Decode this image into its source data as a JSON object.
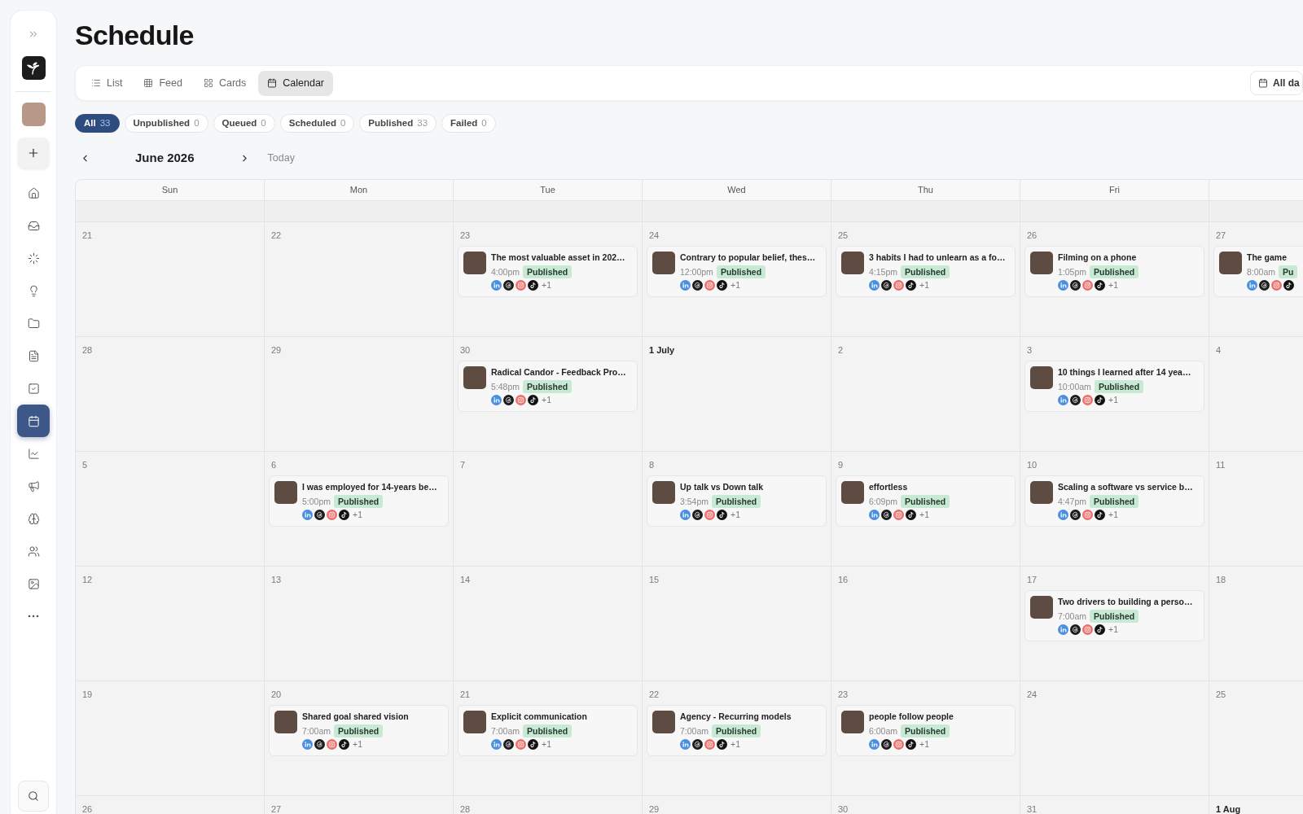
{
  "sidebar": {
    "nav": [
      {
        "kind": "home",
        "selected": false
      },
      {
        "kind": "inbox",
        "selected": false
      },
      {
        "kind": "loader",
        "selected": false
      },
      {
        "kind": "lightbulb",
        "selected": false
      },
      {
        "kind": "folder",
        "selected": false
      },
      {
        "kind": "document",
        "selected": false
      },
      {
        "kind": "checklist",
        "selected": false
      },
      {
        "kind": "calendar",
        "selected": true
      },
      {
        "kind": "chart",
        "selected": false
      },
      {
        "kind": "megaphone",
        "selected": false
      },
      {
        "kind": "brain",
        "selected": false
      },
      {
        "kind": "users",
        "selected": false
      },
      {
        "kind": "image",
        "selected": false
      },
      {
        "kind": "more",
        "selected": false
      }
    ]
  },
  "page": {
    "title": "Schedule"
  },
  "view_tabs": [
    {
      "kind": "list",
      "label": "List",
      "selected": false
    },
    {
      "kind": "feed",
      "label": "Feed",
      "selected": false
    },
    {
      "kind": "cards",
      "label": "Cards",
      "selected": false
    },
    {
      "kind": "calendar",
      "label": "Calendar",
      "selected": true
    }
  ],
  "date_range_button": {
    "label": "All da"
  },
  "filters": [
    {
      "label": "All",
      "count": "33",
      "selected": true
    },
    {
      "label": "Unpublished",
      "count": "0",
      "selected": false
    },
    {
      "label": "Queued",
      "count": "0",
      "selected": false
    },
    {
      "label": "Scheduled",
      "count": "0",
      "selected": false
    },
    {
      "label": "Published",
      "count": "33",
      "selected": false
    },
    {
      "label": "Failed",
      "count": "0",
      "selected": false
    }
  ],
  "month_nav": {
    "month": "June 2026",
    "today": "Today"
  },
  "calendar": {
    "weekdays": [
      "Sun",
      "Mon",
      "Tue",
      "Wed",
      "Thu",
      "Fri"
    ],
    "weeks": [
      {
        "days": [
          {
            "date": "21",
            "month_start": false
          },
          {
            "date": "22",
            "month_start": false
          },
          {
            "date": "23",
            "month_start": false,
            "posts": [
              {
                "title": "The most valuable asset in 202…",
                "time": "4:00pm",
                "status": "Published",
                "more": "+1"
              }
            ]
          },
          {
            "date": "24",
            "month_start": false,
            "posts": [
              {
                "title": "Contrary to popular belief, thes…",
                "time": "12:00pm",
                "status": "Published",
                "more": "+1"
              }
            ]
          },
          {
            "date": "25",
            "month_start": false,
            "posts": [
              {
                "title": "3 habits I had to unlearn as a fo…",
                "time": "4:15pm",
                "status": "Published",
                "more": "+1"
              }
            ]
          },
          {
            "date": "26",
            "month_start": false,
            "posts": [
              {
                "title": "Filming on a phone",
                "time": "1:05pm",
                "status": "Published",
                "more": "+1"
              }
            ]
          },
          {
            "date": "27",
            "month_start": false,
            "posts": [
              {
                "title": "The game",
                "time": "8:00am",
                "status": "Pu"
              }
            ]
          }
        ]
      },
      {
        "days": [
          {
            "date": "28",
            "month_start": false
          },
          {
            "date": "29",
            "month_start": false
          },
          {
            "date": "30",
            "month_start": false,
            "posts": [
              {
                "title": "Radical Candor - Feedback Pro…",
                "time": "5:48pm",
                "status": "Published",
                "more": "+1"
              }
            ]
          },
          {
            "date": "1 July",
            "month_start": true
          },
          {
            "date": "2",
            "month_start": false
          },
          {
            "date": "3",
            "month_start": false,
            "posts": [
              {
                "title": "10 things I learned after 14 yea…",
                "time": "10:00am",
                "status": "Published",
                "more": "+1"
              }
            ]
          },
          {
            "date": "4",
            "month_start": false
          }
        ]
      },
      {
        "days": [
          {
            "date": "5",
            "month_start": false
          },
          {
            "date": "6",
            "month_start": false,
            "posts": [
              {
                "title": "I was employed for 14-years be…",
                "time": "5:00pm",
                "status": "Published",
                "more": "+1"
              }
            ]
          },
          {
            "date": "7",
            "month_start": false
          },
          {
            "date": "8",
            "month_start": false,
            "posts": [
              {
                "title": "Up talk vs Down talk",
                "time": "3:54pm",
                "status": "Published",
                "more": "+1"
              }
            ]
          },
          {
            "date": "9",
            "month_start": false,
            "posts": [
              {
                "title": "effortless",
                "time": "6:09pm",
                "status": "Published",
                "more": "+1"
              }
            ]
          },
          {
            "date": "10",
            "month_start": false,
            "posts": [
              {
                "title": "Scaling a software vs service b…",
                "time": "4:47pm",
                "status": "Published",
                "more": "+1"
              }
            ]
          },
          {
            "date": "11",
            "month_start": false
          }
        ]
      },
      {
        "days": [
          {
            "date": "12",
            "month_start": false
          },
          {
            "date": "13",
            "month_start": false
          },
          {
            "date": "14",
            "month_start": false
          },
          {
            "date": "15",
            "month_start": false
          },
          {
            "date": "16",
            "month_start": false
          },
          {
            "date": "17",
            "month_start": false,
            "posts": [
              {
                "title": "Two drivers to building a perso…",
                "time": "7:00am",
                "status": "Published",
                "more": "+1"
              }
            ]
          },
          {
            "date": "18",
            "month_start": false
          }
        ]
      },
      {
        "days": [
          {
            "date": "19",
            "month_start": false
          },
          {
            "date": "20",
            "month_start": false,
            "posts": [
              {
                "title": "Shared goal shared vision",
                "time": "7:00am",
                "status": "Published",
                "more": "+1"
              }
            ]
          },
          {
            "date": "21",
            "month_start": false,
            "posts": [
              {
                "title": "Explicit communication",
                "time": "7:00am",
                "status": "Published",
                "more": "+1"
              }
            ]
          },
          {
            "date": "22",
            "month_start": false,
            "posts": [
              {
                "title": "Agency - Recurring models",
                "time": "7:00am",
                "status": "Published",
                "more": "+1"
              }
            ]
          },
          {
            "date": "23",
            "month_start": false,
            "posts": [
              {
                "title": "people follow people",
                "time": "6:00am",
                "status": "Published",
                "more": "+1"
              }
            ]
          },
          {
            "date": "24",
            "month_start": false
          },
          {
            "date": "25",
            "month_start": false
          }
        ]
      },
      {
        "days": [
          {
            "date": "26",
            "month_start": false
          },
          {
            "date": "27",
            "month_start": false
          },
          {
            "date": "28",
            "month_start": false
          },
          {
            "date": "29",
            "month_start": false
          },
          {
            "date": "30",
            "month_start": false
          },
          {
            "date": "31",
            "month_start": false
          },
          {
            "date": "1 Aug",
            "month_start": true
          }
        ]
      }
    ]
  }
}
